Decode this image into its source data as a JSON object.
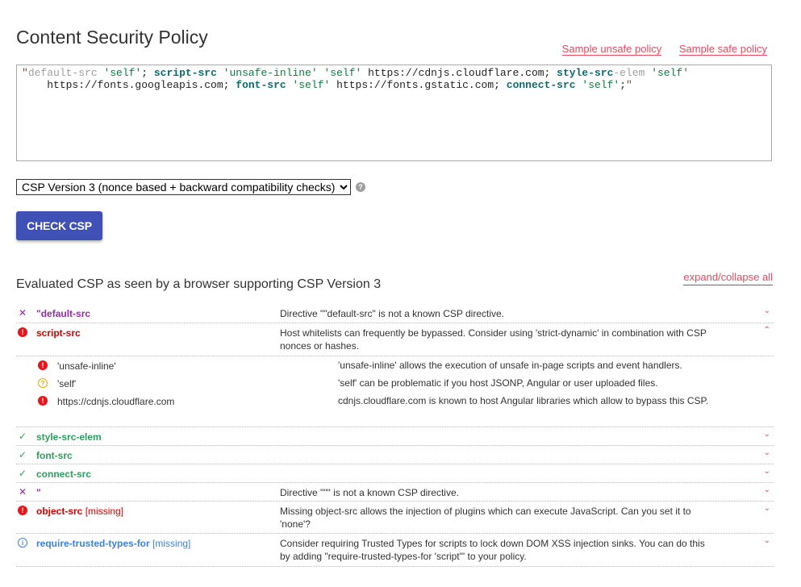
{
  "page": {
    "title": "Content Security Policy"
  },
  "links": {
    "unsafe": "Sample unsafe policy",
    "safe": "Sample safe policy"
  },
  "policy": {
    "q1": "\"",
    "t1": "default-src",
    "t2": " 'self'",
    "p1": "; ",
    "t3": "script-src",
    "t4": " 'unsafe-inline' 'self' ",
    "t5": "https://cdnjs.cloudflare.com",
    "p2": "; ",
    "t6": "style-src",
    "t6b": "-elem",
    "t7": " 'self'",
    "nl": "\n    ",
    "t8": "https://fonts.googleapis.com",
    "p3": "; ",
    "t9": "font-src",
    "t10": " 'self' ",
    "t11": "https://fonts.gstatic.com",
    "p4": "; ",
    "t12": "connect-src",
    "t13": " 'self'",
    "p5": ";",
    "q2": "\""
  },
  "version": {
    "selected": "CSP Version 3 (nonce based + backward compatibility checks)",
    "help": "?"
  },
  "check_button": "CHECK CSP",
  "eval": {
    "title": "Evaluated CSP as seen by a browser supporting CSP Version 3",
    "expand_all": "expand/collapse all",
    "rows": [
      {
        "directive": "\"default-src",
        "desc": "Directive \"\"default-src\" is not a known CSP directive."
      },
      {
        "directive": "script-src",
        "desc": "Host whitelists can frequently be bypassed. Consider using 'strict-dynamic' in combination with CSP nonces or hashes."
      },
      {
        "directive": "style-src-elem",
        "desc": ""
      },
      {
        "directive": "font-src",
        "desc": ""
      },
      {
        "directive": "connect-src",
        "desc": ""
      },
      {
        "directive": "\"",
        "desc": "Directive \"\"\" is not a known CSP directive."
      },
      {
        "directive": "object-src",
        "missing": "[missing]",
        "desc": "Missing object-src allows the injection of plugins which can execute JavaScript. Can you set it to 'none'?"
      },
      {
        "directive": "require-trusted-types-for",
        "missing": "[missing]",
        "desc": "Consider requiring Trusted Types for scripts to lock down DOM XSS injection sinks. You can do this by adding \"require-trusted-types-for 'script'\" to your policy."
      }
    ],
    "script_sub": [
      {
        "value": "'unsafe-inline'",
        "desc": "'unsafe-inline' allows the execution of unsafe in-page scripts and event handlers."
      },
      {
        "value": "'self'",
        "desc": "'self' can be problematic if you host JSONP, Angular or user uploaded files."
      },
      {
        "value": "https://cdnjs.cloudflare.com",
        "desc": "cdnjs.cloudflare.com is known to host Angular libraries which allow to bypass this CSP."
      }
    ]
  },
  "icons": {
    "error": "!",
    "warning": "?",
    "info": "i",
    "invalid": "✕",
    "ok": "✓",
    "chev_down": "⌄",
    "chev_up": "⌃"
  },
  "colors": {
    "accent": "#3f51b5",
    "link": "#e84a5f",
    "error": "#e8141c",
    "ok": "#2e9e5b",
    "invalid": "#9c27b0",
    "info": "#3f7fe0"
  }
}
